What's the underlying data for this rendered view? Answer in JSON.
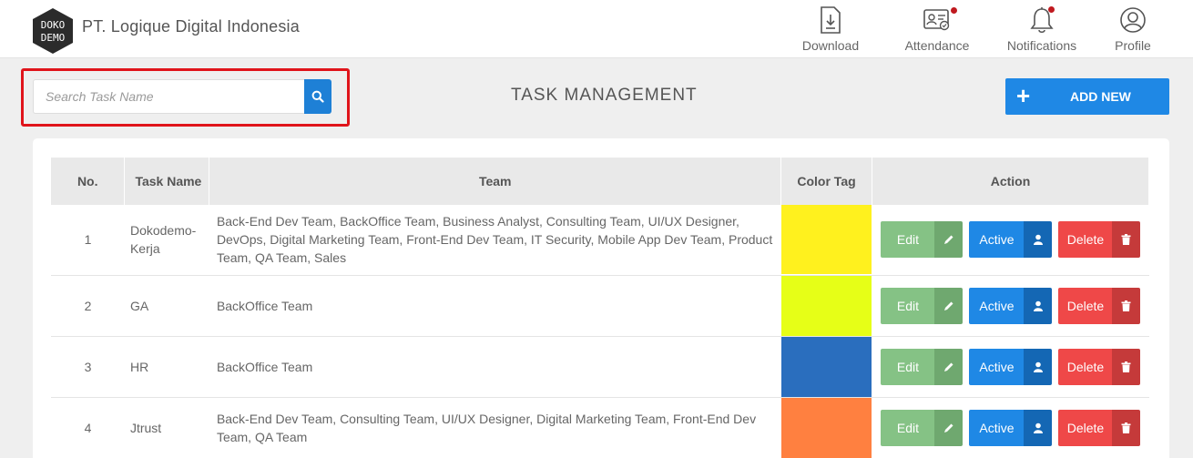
{
  "header": {
    "logo_text_line1": "DOKO",
    "logo_text_line2": "DEMO",
    "company": "PT. Logique Digital Indonesia",
    "nav": [
      {
        "label": "Download",
        "icon": "download-icon"
      },
      {
        "label": "Attendance",
        "icon": "attendance-icon",
        "badge": true
      },
      {
        "label": "Notifications",
        "icon": "bell-icon",
        "badge": true
      },
      {
        "label": "Profile",
        "icon": "profile-icon"
      }
    ]
  },
  "search": {
    "placeholder": "Search Task Name",
    "value": ""
  },
  "page_title": "TASK MANAGEMENT",
  "add_button": {
    "plus": "+",
    "label": "ADD NEW"
  },
  "table": {
    "columns": [
      "No.",
      "Task Name",
      "Team",
      "Color Tag",
      "Action"
    ],
    "rows": [
      {
        "no": "1",
        "task": "Dokodemo-Kerja",
        "team": "Back-End Dev Team, BackOffice Team, Business Analyst, Consulting Team, UI/UX Designer, DevOps, Digital Marketing Team, Front-End Dev Team, IT Security, Mobile App Dev Team, Product Team, QA Team, Sales",
        "color": "#fff11e"
      },
      {
        "no": "2",
        "task": "GA",
        "team": "BackOffice Team",
        "color": "#e6ff17"
      },
      {
        "no": "3",
        "task": "HR",
        "team": "BackOffice Team",
        "color": "#2a6ebe"
      },
      {
        "no": "4",
        "task": "Jtrust",
        "team": "Back-End Dev Team, Consulting Team, UI/UX Designer, Digital Marketing Team, Front-End Dev Team, QA Team",
        "color": "#ff8040"
      }
    ],
    "actions": {
      "edit": "Edit",
      "active": "Active",
      "delete": "Delete"
    }
  },
  "colors": {
    "primary": "#1f88e5",
    "edit": "#85c285",
    "delete": "#ef4848",
    "highlight": "#e0141b"
  }
}
